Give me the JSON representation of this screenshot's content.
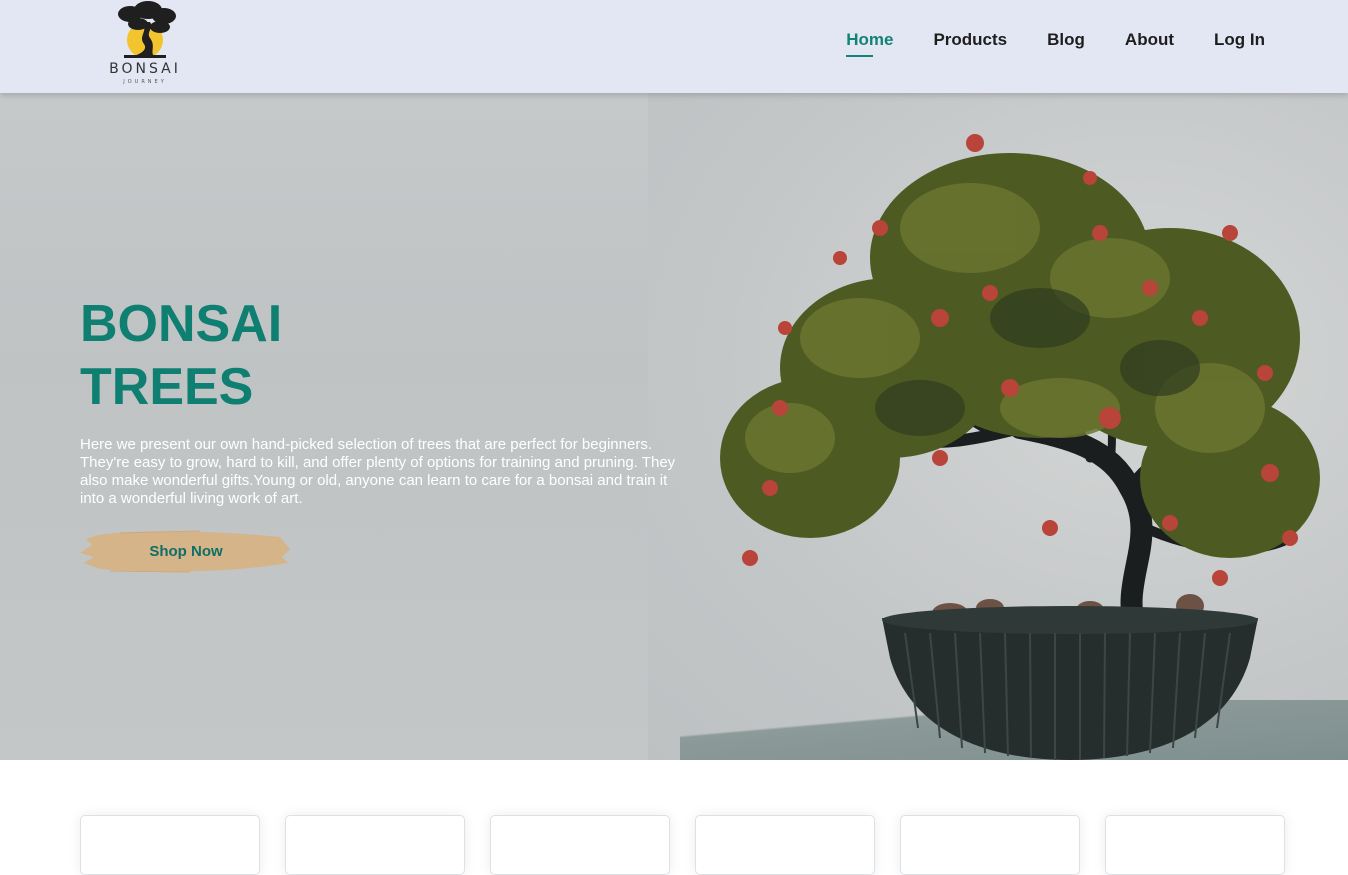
{
  "logo": {
    "word": "BONSAI",
    "sub": "JOURNEY",
    "icon": "bonsai-logo-icon"
  },
  "nav": {
    "items": [
      {
        "label": "Home",
        "active": true
      },
      {
        "label": "Products",
        "active": false
      },
      {
        "label": "Blog",
        "active": false
      },
      {
        "label": "About",
        "active": false
      },
      {
        "label": "Log In",
        "active": false
      }
    ]
  },
  "hero": {
    "title_line1": "BONSAI",
    "title_line2": "TREES",
    "description": "Here we present our own hand-picked selection of trees that are perfect for beginners. They're easy to grow, hard to kill, and offer plenty of options for training and pruning. They also make wonderful gifts.Young or old, anyone can learn to care for a bonsai and train it into a wonderful living work of art.",
    "button_label": "Shop Now",
    "image": "bonsai-tree-photo"
  },
  "cards": {
    "count": 6
  },
  "colors": {
    "accent": "#128374",
    "nav_bg": "#e3e7f3",
    "button_brush": "#d5b48a",
    "hero_bg": "#c3c6c7"
  }
}
